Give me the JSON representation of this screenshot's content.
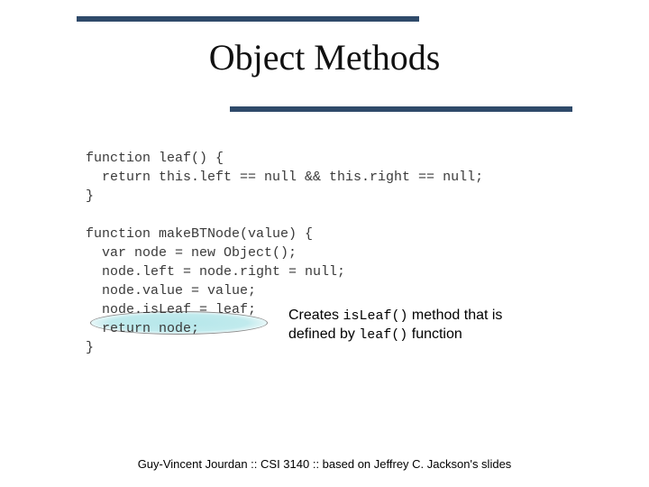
{
  "title": "Object Methods",
  "code": {
    "line1": "function leaf() {",
    "line2": "  return this.left == null && this.right == null;",
    "line3": "}",
    "line4": "",
    "line5": "function makeBTNode(value) {",
    "line6": "  var node = new Object();",
    "line7": "  node.left = node.right = null;",
    "line8": "  node.value = value;",
    "line9": "  node.isLeaf = leaf;",
    "line10": "  return node;",
    "line11": "}"
  },
  "annotation": {
    "part1": "Creates ",
    "mono1": "isLeaf()",
    "part2": " method that is",
    "part3": "defined by ",
    "mono2": "leaf()",
    "part4": " function"
  },
  "footer": "Guy-Vincent Jourdan :: CSI 3140 :: based on Jeffrey C. Jackson's slides"
}
